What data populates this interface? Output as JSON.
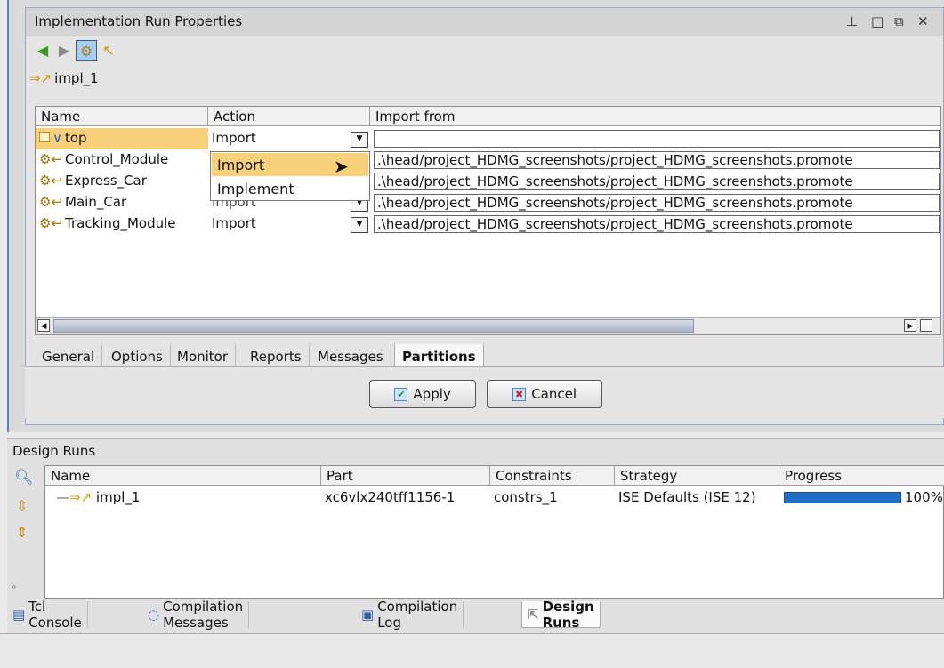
{
  "props_panel": {
    "title": "Implementation Run Properties",
    "window_controls": [
      "⊥",
      "□",
      "⧉",
      "✕"
    ],
    "run_label": "impl_1"
  },
  "partitions_table": {
    "columns": [
      "Name",
      "Action",
      "Import from"
    ],
    "rows": [
      {
        "name": "top",
        "action": "Import",
        "import_from": ""
      },
      {
        "name": "Control_Module",
        "action": "Import",
        "import_from": ".\\head/project_HDMG_screenshots/project_HDMG_screenshots.promote"
      },
      {
        "name": "Express_Car",
        "action": "Import",
        "import_from": ".\\head/project_HDMG_screenshots/project_HDMG_screenshots.promote"
      },
      {
        "name": "Main_Car",
        "action": "Import",
        "import_from": ".\\head/project_HDMG_screenshots/project_HDMG_screenshots.promote"
      },
      {
        "name": "Tracking_Module",
        "action": "Import",
        "import_from": ".\\head/project_HDMG_screenshots/project_HDMG_screenshots.promote"
      }
    ],
    "dropdown_options": [
      "Import",
      "Implement"
    ],
    "dropdown_highlighted": "Import"
  },
  "props_tabs": [
    "General",
    "Options",
    "Monitor",
    "Reports",
    "Messages",
    "Partitions"
  ],
  "active_props_tab": "Partitions",
  "buttons": {
    "apply": "Apply",
    "cancel": "Cancel"
  },
  "design_runs": {
    "title": "Design Runs",
    "columns": [
      "Name",
      "Part",
      "Constraints",
      "Strategy",
      "Progress"
    ],
    "rows": [
      {
        "name": "impl_1",
        "part": "xc6vlx240tff1156-1",
        "constraints": "constrs_1",
        "strategy": "ISE Defaults (ISE 12)",
        "progress": "100%",
        "progress_value": 100
      }
    ]
  },
  "bottom_tabs": [
    "Tcl Console",
    "Compilation Messages",
    "Compilation Log",
    "Design Runs"
  ],
  "active_bottom_tab": "Design Runs",
  "colors": {
    "selected_row": "#f8d07a",
    "progress_fill": "#1e6fc8",
    "accent_border": "#5a7fd1"
  }
}
